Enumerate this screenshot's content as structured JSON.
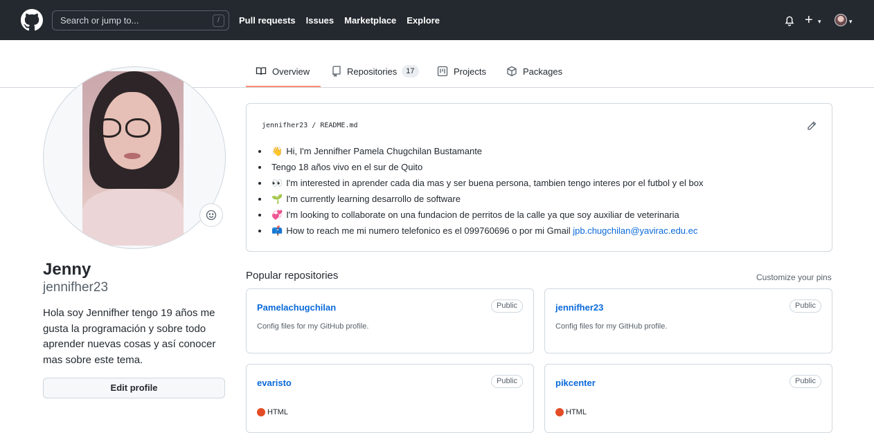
{
  "header": {
    "search_placeholder": "Search or jump to...",
    "search_shortcut": "/",
    "nav": [
      "Pull requests",
      "Issues",
      "Marketplace",
      "Explore"
    ],
    "plus": "+",
    "caret": "▾"
  },
  "tabs": [
    {
      "label": "Overview",
      "icon": "book-icon",
      "active": true
    },
    {
      "label": "Repositories",
      "icon": "repo-icon",
      "count": "17"
    },
    {
      "label": "Projects",
      "icon": "project-icon"
    },
    {
      "label": "Packages",
      "icon": "package-icon"
    }
  ],
  "profile": {
    "name": "Jenny",
    "login": "jennifher23",
    "bio": "Hola soy Jennifher tengo 19 años me gusta la programación y sobre todo aprender nuevas cosas y así conocer mas sobre este tema.",
    "edit_label": "Edit profile"
  },
  "readme": {
    "user": "jennifher23",
    "separator": "/",
    "file": "README.md",
    "items": [
      {
        "emoji": "👋",
        "text": "Hi, I'm Jennifher Pamela Chugchilan Bustamante"
      },
      {
        "emoji": "",
        "text": "Tengo 18 años vivo en el sur de Quito"
      },
      {
        "emoji": "👀",
        "text": "I'm interested in aprender cada dia mas y ser buena persona, tambien tengo interes por el futbol y el box"
      },
      {
        "emoji": "🌱",
        "text": "I'm currently learning desarrollo de software"
      },
      {
        "emoji": "💞️",
        "text": "I'm looking to collaborate on una fundacion de perritos de la calle ya que soy auxiliar de veterinaria"
      },
      {
        "emoji": "📫",
        "text": "How to reach me mi numero telefonico es el 099760696 o por mi Gmail ",
        "link": "jpb.chugchilan@yavirac.edu.ec"
      }
    ]
  },
  "popular": {
    "title": "Popular repositories",
    "customize": "Customize your pins",
    "repos": [
      {
        "name": "Pamelachugchilan",
        "visibility": "Public",
        "description": "Config files for my GitHub profile.",
        "language": ""
      },
      {
        "name": "jennifher23",
        "visibility": "Public",
        "description": "Config files for my GitHub profile.",
        "language": ""
      },
      {
        "name": "evaristo",
        "visibility": "Public",
        "description": "",
        "language": "HTML",
        "lang_color": "#e34c26"
      },
      {
        "name": "pikcenter",
        "visibility": "Public",
        "description": "",
        "language": "HTML",
        "lang_color": "#e34c26"
      }
    ]
  },
  "colors": {
    "header_bg": "#24292f",
    "link": "#0969da",
    "tab_underline": "#fd8c73"
  }
}
